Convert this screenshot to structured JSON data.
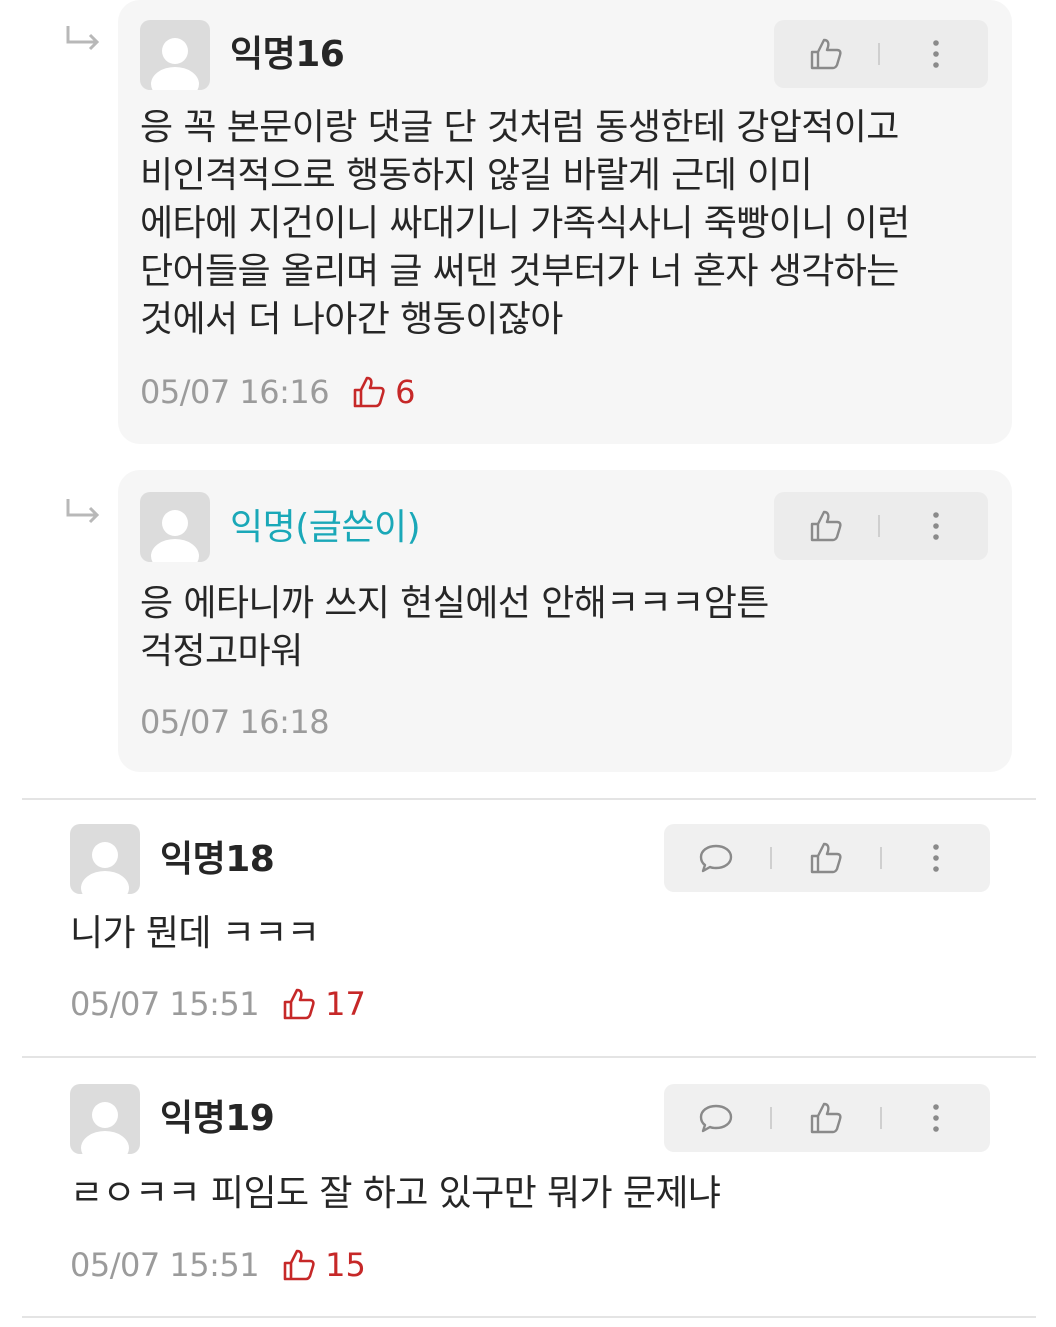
{
  "colors": {
    "author_name": "#1aa8b8",
    "vote": "#c62828",
    "meta_text": "#9b9b9b",
    "reply_bg": "#f6f6f6",
    "action_bg": "#f0f0f0"
  },
  "icons": {
    "reply": "reply-arrow-icon",
    "avatar": "default-avatar-icon",
    "like": "thumbs-up-icon",
    "comment": "speech-bubble-icon",
    "more": "more-vertical-icon"
  },
  "replies": [
    {
      "name": "익명16",
      "text": "응 꼭 본문이랑 댓글 단 것처럼 동생한테 강압적이고\n비인격적으로 행동하지 않길 바랄게 근데 이미\n에타에 지건이니 싸대기니 가족식사니 죽빵이니 이런\n단어들을 올리며 글 써댄 것부터가 너 혼자 생각하는\n것에서 더 나아간 행동이잖아",
      "time": "05/07 16:16",
      "votes": "6"
    },
    {
      "name": "익명(글쓴이)",
      "text": "응 에타니까 쓰지 현실에선 안해ㅋㅋㅋ암튼\n걱정고마워",
      "time": "05/07 16:18"
    }
  ],
  "comments": [
    {
      "name": "익명18",
      "text": "니가 뭔데 ㅋㅋㅋ",
      "time": "05/07 15:51",
      "votes": "17"
    },
    {
      "name": "익명19",
      "text": "ㄹㅇㅋㅋ 피임도 잘 하고 있구만 뭐가 문제냐",
      "time": "05/07 15:51",
      "votes": "15"
    }
  ]
}
